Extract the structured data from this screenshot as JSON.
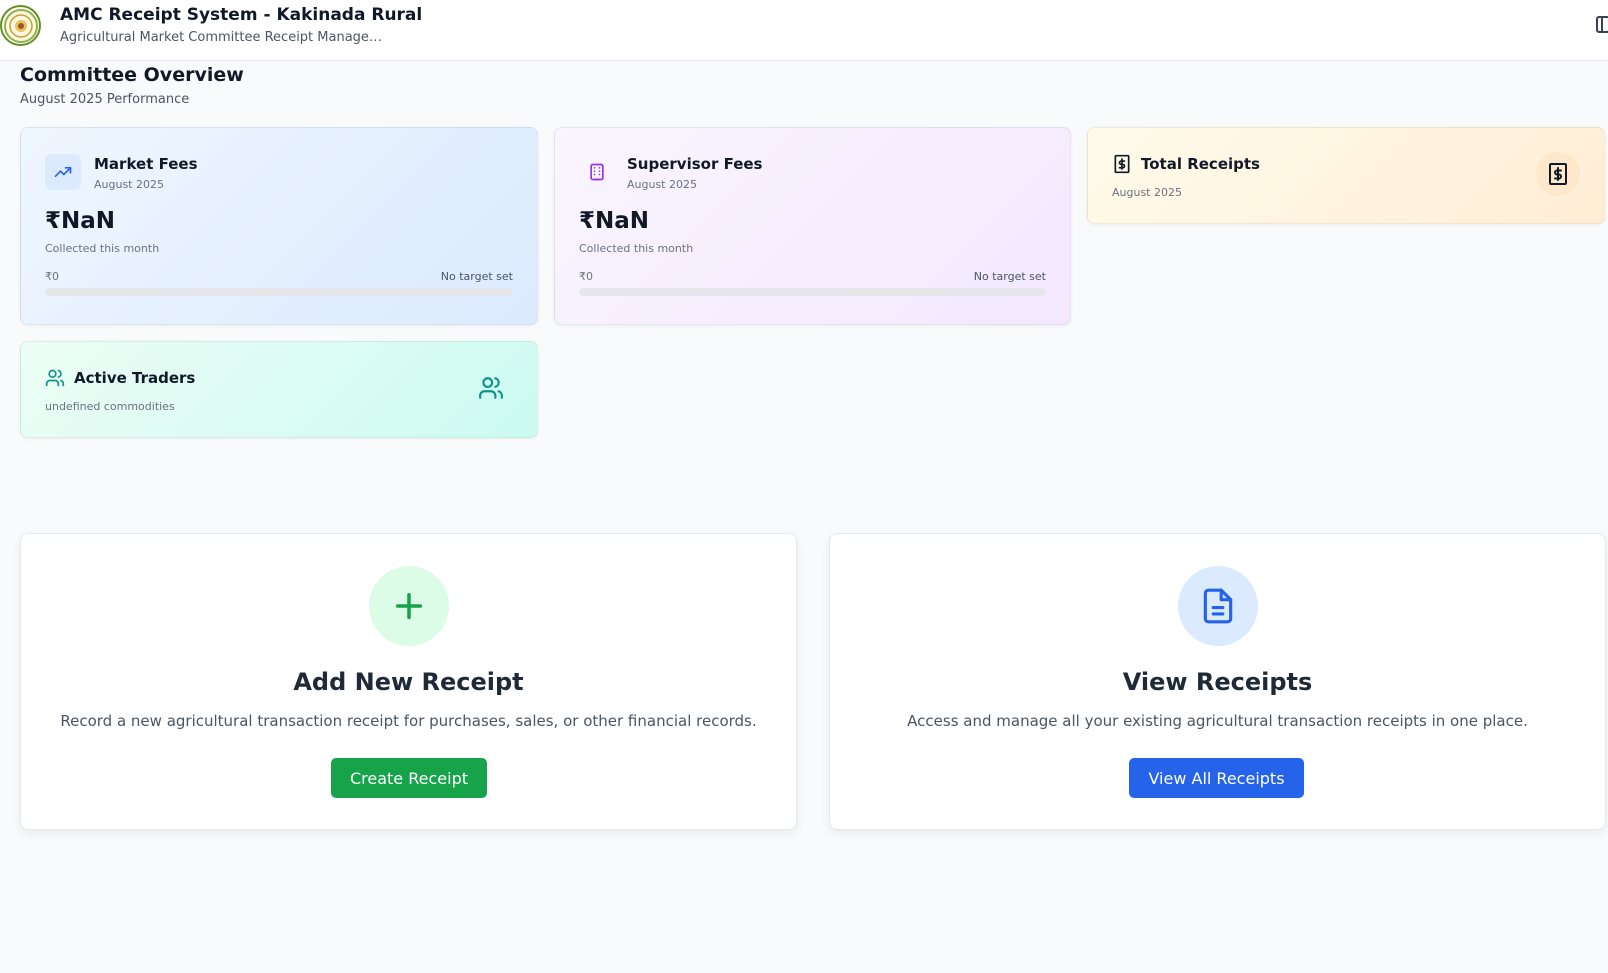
{
  "header": {
    "app_title": "AMC Receipt System - Kakinada Rural",
    "app_subtitle": "Agricultural Market Committee Receipt Manage…"
  },
  "overview": {
    "title": "Committee Overview",
    "subtitle": "August 2025 Performance"
  },
  "stats": {
    "market_fees": {
      "title": "Market Fees",
      "period": "August 2025",
      "value": "₹NaN",
      "caption": "Collected this month",
      "min": "₹0",
      "target": "No target set",
      "progress_percent": 0,
      "accent": "#2563eb"
    },
    "supervisor_fees": {
      "title": "Supervisor Fees",
      "period": "August 2025",
      "value": "₹NaN",
      "caption": "Collected this month",
      "min": "₹0",
      "target": "No target set",
      "progress_percent": 0,
      "accent": "#9333ea"
    },
    "total_receipts": {
      "title": "Total Receipts",
      "period": "August 2025",
      "accent": "#111827"
    },
    "active_traders": {
      "title": "Active Traders",
      "caption": "undefined commodities",
      "accent": "#0d9488"
    }
  },
  "actions": {
    "add": {
      "title": "Add New Receipt",
      "description": "Record a new agricultural transaction receipt for purchases, sales, or other financial records.",
      "button": "Create Receipt",
      "accent": "#16a34a"
    },
    "view": {
      "title": "View Receipts",
      "description": "Access and manage all your existing agricultural transaction receipts in one place.",
      "button": "View All Receipts",
      "accent": "#2563eb"
    }
  },
  "icons": {
    "logo": "state-emblem-logo",
    "sidebar_toggle": "panel-left-icon",
    "market_fees": "trending-up-icon",
    "supervisor_fees": "building-icon",
    "total_receipts": "receipt-dollar-icon",
    "active_traders": "users-icon",
    "add": "plus-icon",
    "view": "file-text-icon"
  }
}
